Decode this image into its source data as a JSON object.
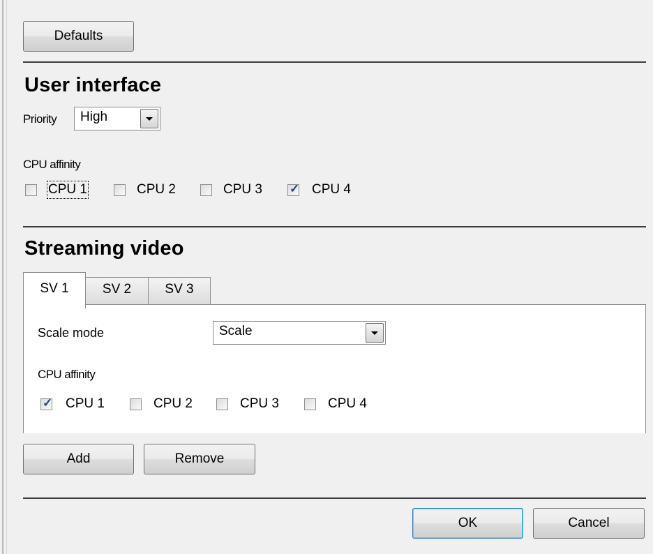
{
  "buttons": {
    "defaults": "Defaults",
    "add": "Add",
    "remove": "Remove",
    "ok": "OK",
    "cancel": "Cancel"
  },
  "user_interface": {
    "heading": "User interface",
    "priority_label": "Priority",
    "priority_value": "High",
    "cpu_affinity_label": "CPU affinity",
    "cpus": [
      {
        "label": "CPU 1",
        "checked": false,
        "focused": true
      },
      {
        "label": "CPU 2",
        "checked": false
      },
      {
        "label": "CPU 3",
        "checked": false
      },
      {
        "label": "CPU 4",
        "checked": true
      }
    ]
  },
  "streaming_video": {
    "heading": "Streaming video",
    "tabs": [
      {
        "label": "SV 1",
        "active": true
      },
      {
        "label": "SV 2",
        "active": false
      },
      {
        "label": "SV 3",
        "active": false
      }
    ],
    "scale_mode_label": "Scale mode",
    "scale_mode_value": "Scale",
    "cpu_affinity_label": "CPU affinity",
    "cpus": [
      {
        "label": "CPU 1",
        "checked": true
      },
      {
        "label": "CPU 2",
        "checked": false
      },
      {
        "label": "CPU 3",
        "checked": false
      },
      {
        "label": "CPU 4",
        "checked": false
      }
    ]
  },
  "icons": {
    "check": "checkmark-icon",
    "dropdown": "chevron-down-icon"
  }
}
